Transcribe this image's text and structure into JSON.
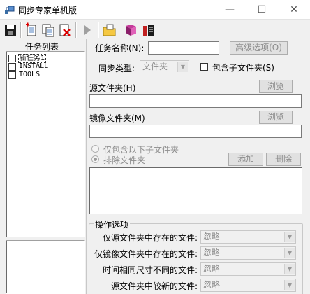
{
  "window": {
    "title": "同步专家单机版",
    "minimize": "—",
    "maximize": "☐",
    "close": "✕"
  },
  "toolbar": {
    "buttons": [
      "save-icon",
      "new-task-icon",
      "copy-task-icon",
      "delete-task-icon",
      "run-icon",
      "open-folder-icon",
      "book-icon",
      "settings-icon"
    ]
  },
  "task_list": {
    "title": "任务列表",
    "items": [
      "新任务1",
      "INSTALL",
      "TOOLS"
    ]
  },
  "form": {
    "task_name_label": "任务名称(N):",
    "task_name_value": "",
    "advanced_button": "高级选项(O)",
    "sync_type_label": "同步类型:",
    "sync_type_value": "文件夹",
    "include_subfolders_label": "包含子文件夹(S)",
    "source_folder_label": "源文件夹(H)",
    "source_folder_value": "",
    "browse_label": "浏览",
    "mirror_folder_label": "镜像文件夹(M)",
    "mirror_folder_value": "",
    "only_include_label": "仅包含以下子文件夹",
    "exclude_label": "排除文件夹",
    "add_button": "添加",
    "delete_button": "删除"
  },
  "operations": {
    "title": "操作选项",
    "rows": [
      {
        "label": "仅源文件夹中存在的文件:",
        "value": "忽略"
      },
      {
        "label": "仅镜像文件夹中存在的文件:",
        "value": "忽略"
      },
      {
        "label": "时间相同尺寸不同的文件:",
        "value": "忽略"
      },
      {
        "label": "源文件夹中较新的文件:",
        "value": "忽略"
      }
    ]
  }
}
